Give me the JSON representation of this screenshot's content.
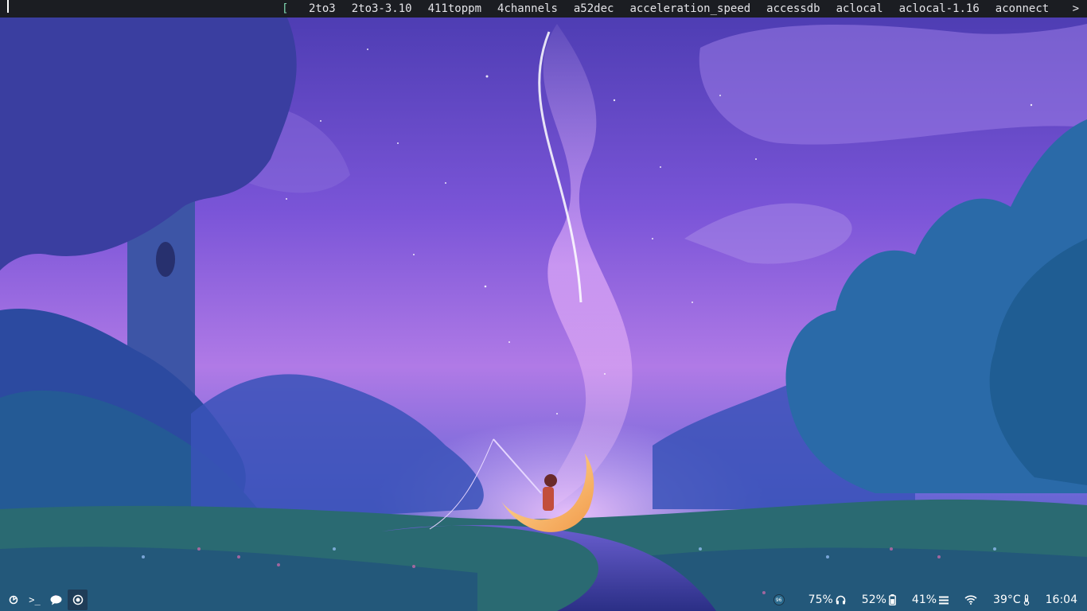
{
  "dmenu": {
    "open_bracket": "[",
    "items": [
      "2to3",
      "2to3-3.10",
      "411toppm",
      "4channels",
      "a52dec",
      "acceleration_speed",
      "accessdb",
      "aclocal",
      "aclocal-1.16",
      "aconnect"
    ],
    "more_indicator": ">"
  },
  "bottom_left": {
    "icons": [
      "system-menu-icon",
      "terminal-icon",
      "chat-bubble-icon",
      "record-icon"
    ],
    "terminal_glyph": ">_"
  },
  "status": {
    "tray_avatar_text": "96",
    "volume": "75%",
    "brightness": "52%",
    "memory": "41%",
    "temperature": "39°C",
    "clock": "16:04"
  },
  "colors": {
    "bar_bg": "#1b1d22",
    "bracket": "#7fd6b0",
    "active_icon_bg": "#1f3d58"
  }
}
